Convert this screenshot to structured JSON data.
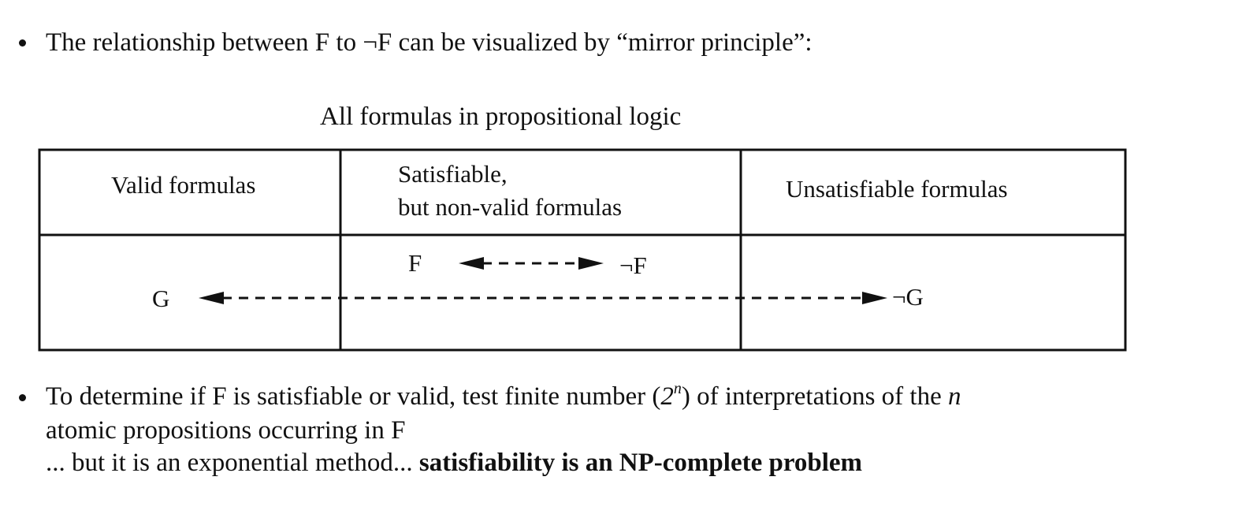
{
  "bullet1": {
    "text": "The relationship between F to ¬F can be visualized by “mirror principle”:"
  },
  "table": {
    "title": "All formulas in propositional logic",
    "columns": {
      "valid": "Valid formulas",
      "satisfiable_line1": "Satisfiable,",
      "satisfiable_line2": "but non-valid formulas",
      "unsatisfiable": "Unsatisfiable formulas"
    },
    "symbols": {
      "F": "F",
      "notF": "¬F",
      "G": "G",
      "notG": "¬G"
    }
  },
  "bullet2": {
    "line1_part1": "To determine if F is satisfiable or valid, test finite number (",
    "line1_two": "2",
    "line1_exp": "n",
    "line1_part2": ") of interpretations of the ",
    "line1_n": "n",
    "line2": "atomic propositions occurring in F",
    "line3_part1": "... but it is an exponential method... ",
    "line3_bold": "satisfiability is an NP-complete problem"
  }
}
